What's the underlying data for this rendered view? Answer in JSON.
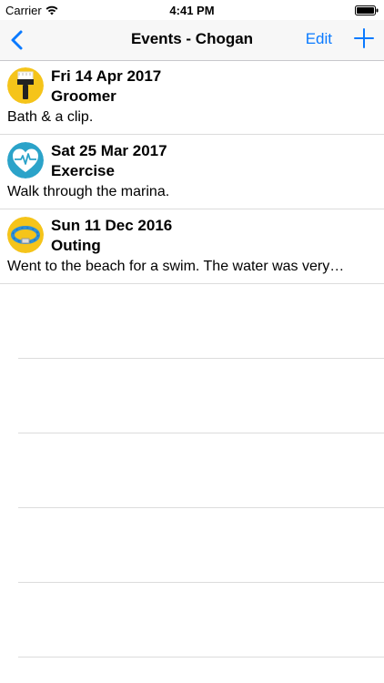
{
  "status_bar": {
    "carrier": "Carrier",
    "time": "4:41 PM"
  },
  "nav": {
    "title": "Events - Chogan",
    "edit_label": "Edit"
  },
  "events": [
    {
      "date": "Fri 14 Apr 2017",
      "type": "Groomer",
      "note": "Bath & a clip.",
      "icon": "brush-icon",
      "icon_bg": "#f5c41a"
    },
    {
      "date": "Sat 25 Mar 2017",
      "type": "Exercise",
      "note": "Walk through the marina.",
      "icon": "heart-pulse-icon",
      "icon_bg": "#2ba3c9"
    },
    {
      "date": "Sun 11 Dec 2016",
      "type": "Outing",
      "note": "Went to the beach for a swim. The water was very…",
      "icon": "collar-icon",
      "icon_bg": "#f5c41a"
    }
  ],
  "colors": {
    "accent": "#0a7aff"
  }
}
